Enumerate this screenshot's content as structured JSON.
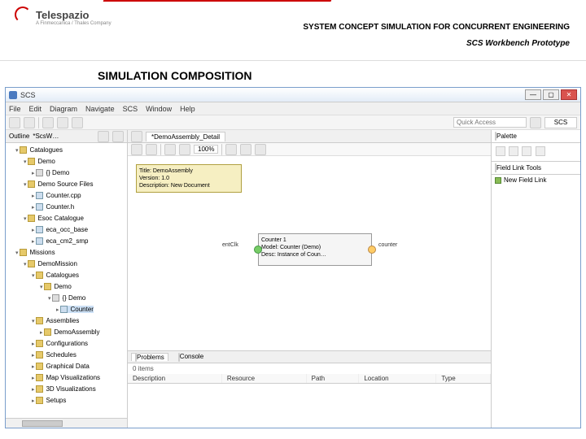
{
  "slide": {
    "logo_name": "Telespazio",
    "logo_sub": "A Finmeccanica / Thales Company",
    "title_main": "SYSTEM CONCEPT SIMULATION FOR CONCURRENT ENGINEERING",
    "title_sub": "SCS Workbench Prototype",
    "section": "SIMULATION COMPOSITION"
  },
  "window": {
    "title": "SCS",
    "buttons": {
      "min": "—",
      "max": "▢",
      "close": "✕"
    }
  },
  "menu": [
    "File",
    "Edit",
    "Diagram",
    "Navigate",
    "SCS",
    "Window",
    "Help"
  ],
  "toolbar": {
    "quick_access": "Quick Access",
    "perspective": "SCS"
  },
  "outline": {
    "tab_label": "Outline",
    "tab_file": "*ScsW…",
    "tree": {
      "root1": "Catalogues",
      "demo": "Demo",
      "demo_pkg": "{} Demo",
      "demo_src": "Demo Source Files",
      "counter_cpp": "Counter.cpp",
      "counter_h": "Counter.h",
      "esa_cat": "Esoc Catalogue",
      "esa1": "eca_occ_base",
      "esa2": "eca_cm2_smp",
      "root2": "Missions",
      "demo_mission": "DemoMission",
      "catalogues2": "Catalogues",
      "demo2": "Demo",
      "demo2_pkg": "{} Demo",
      "counter_sel": "Counter",
      "assemblies": "Assemblies",
      "demo_asm": "DemoAssembly",
      "configs": "Configurations",
      "schedules": "Schedules",
      "graph_data": "Graphical Data",
      "map_vis": "Map Visualizations",
      "vis3d": "3D Visualizations",
      "setups": "Setups"
    }
  },
  "editor": {
    "tab": "*DemoAssembly_Detail",
    "zoom": "100%",
    "doc_title": "Title: DemoAssembly",
    "doc_version": "Version: 1.0",
    "doc_desc": "Description: New Document",
    "model_name": "Counter 1",
    "model_model": "Model: Counter (Demo)",
    "model_desc": "Desc: Instance of Coun…",
    "port_left": "entClk",
    "port_right": "counter"
  },
  "bottom": {
    "tabs": {
      "problems": "Problems",
      "console": "Console"
    },
    "count": "0 items",
    "cols": [
      "Description",
      "Resource",
      "Path",
      "Location",
      "Type"
    ]
  },
  "right": {
    "palette_hdr": "Palette",
    "group1": "Field Link Tools",
    "item1": "New Field Link"
  }
}
